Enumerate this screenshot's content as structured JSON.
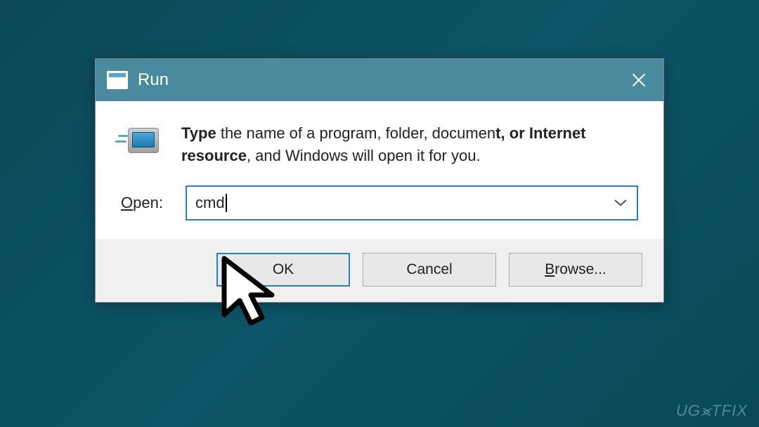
{
  "dialog": {
    "title": "Run",
    "instruction_bold_start": "Type ",
    "instruction_plain_mid": "the name of a program, folder, documen",
    "instruction_bold_mid": "t, or Internet resource",
    "instruction_plain_end": ", and Windows will open it for you.",
    "open_label_ul": "O",
    "open_label_rest": "pen:",
    "input_value": "cmd",
    "buttons": {
      "ok": "OK",
      "cancel": "Cancel",
      "browse_ul": "B",
      "browse_rest": "rowse..."
    }
  },
  "watermark": "UG⪤TFIX"
}
